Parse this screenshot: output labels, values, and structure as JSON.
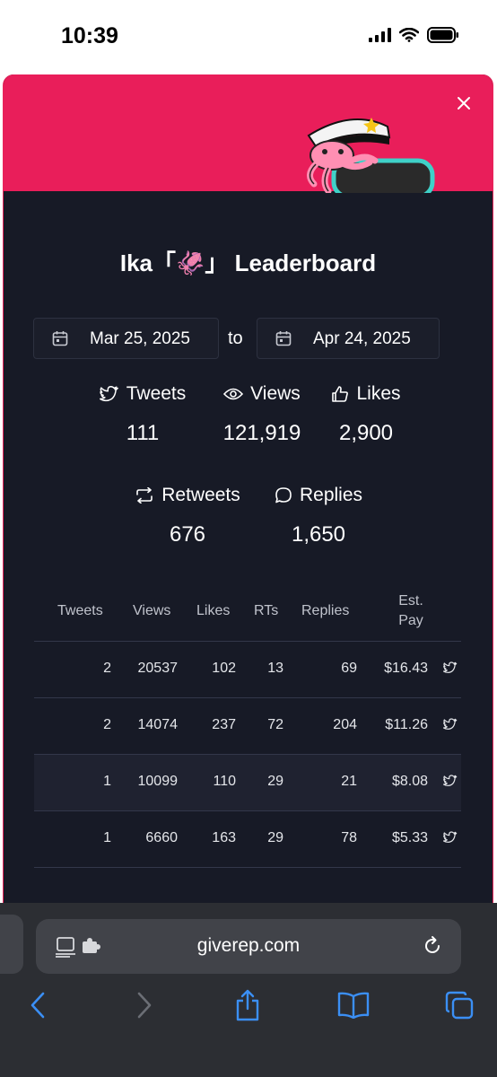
{
  "status_bar": {
    "time": "10:39"
  },
  "modal": {
    "title": "Ika「🦑」 Leaderboard",
    "date_from": "Mar 25, 2025",
    "date_to": "Apr 24, 2025",
    "to_label": "to"
  },
  "stats": {
    "tweets": {
      "label": "Tweets",
      "value": "111"
    },
    "views": {
      "label": "Views",
      "value": "121,919"
    },
    "likes": {
      "label": "Likes",
      "value": "2,900"
    },
    "retweets": {
      "label": "Retweets",
      "value": "676"
    },
    "replies": {
      "label": "Replies",
      "value": "1,650"
    }
  },
  "table": {
    "headers": [
      "Tweets",
      "Views",
      "Likes",
      "RTs",
      "Replies",
      "Est.",
      "Pay"
    ],
    "rows": [
      {
        "tweets": "2",
        "views": "20537",
        "likes": "102",
        "rts": "13",
        "replies": "69",
        "pay": "$16.43"
      },
      {
        "tweets": "2",
        "views": "14074",
        "likes": "237",
        "rts": "72",
        "replies": "204",
        "pay": "$11.26"
      },
      {
        "tweets": "1",
        "views": "10099",
        "likes": "110",
        "rts": "29",
        "replies": "21",
        "pay": "$8.08"
      },
      {
        "tweets": "1",
        "views": "6660",
        "likes": "163",
        "rts": "29",
        "replies": "78",
        "pay": "$5.33"
      }
    ]
  },
  "browser": {
    "url": "giverep.com"
  },
  "colors": {
    "banner": "#e91e5a",
    "modal_bg": "#171a26",
    "browser_bg": "#2c2e33",
    "accent_blue": "#3b8ff5"
  },
  "icons": [
    "calendar-icon",
    "twitter-icon",
    "eye-icon",
    "thumbs-up-icon",
    "retweet-icon",
    "reply-icon",
    "close-icon",
    "reload-icon",
    "share-icon",
    "bookmarks-icon",
    "tabs-icon"
  ]
}
